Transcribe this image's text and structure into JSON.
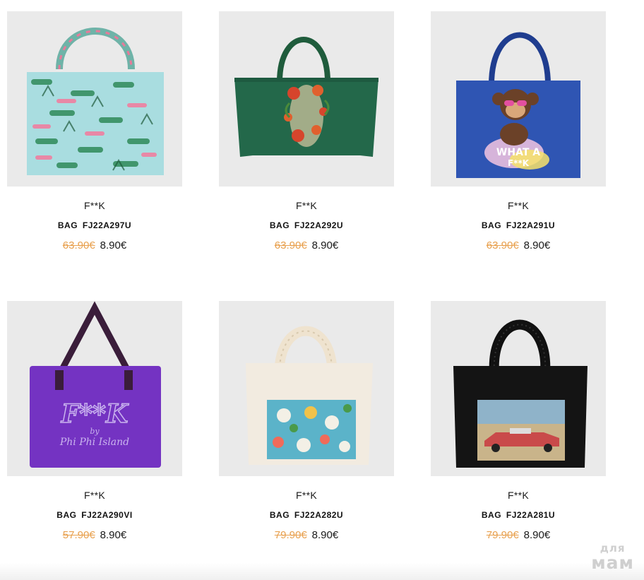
{
  "products": [
    {
      "image_icon": "tote-bag-tropical-print-icon",
      "brand": "F**K",
      "title": "BAG  FJ22A297U",
      "old_price": "63.90€",
      "new_price": "8.90€"
    },
    {
      "image_icon": "tote-bag-green-floral-icon",
      "brand": "F**K",
      "title": "BAG  FJ22A292U",
      "old_price": "63.90€",
      "new_price": "8.90€"
    },
    {
      "image_icon": "tote-bag-blue-monkey-icon",
      "brand": "F**K",
      "title": "BAG  FJ22A291U",
      "old_price": "63.90€",
      "new_price": "8.90€"
    },
    {
      "image_icon": "tote-bag-purple-logo-icon",
      "brand": "F**K",
      "title": "BAG  FJ22A290VI",
      "old_price": "57.90€",
      "new_price": "8.90€"
    },
    {
      "image_icon": "tote-bag-cream-skull-print-icon",
      "brand": "F**K",
      "title": "BAG  FJ22A282U",
      "old_price": "79.90€",
      "new_price": "8.90€"
    },
    {
      "image_icon": "tote-bag-black-car-print-icon",
      "brand": "F**K",
      "title": "BAG  FJ22A281U",
      "old_price": "79.90€",
      "new_price": "8.90€"
    }
  ],
  "watermark": {
    "top": "для",
    "bottom": "мам"
  },
  "colors": {
    "old_price": "#e8a04e",
    "thumb_bg": "#eaeaea"
  }
}
